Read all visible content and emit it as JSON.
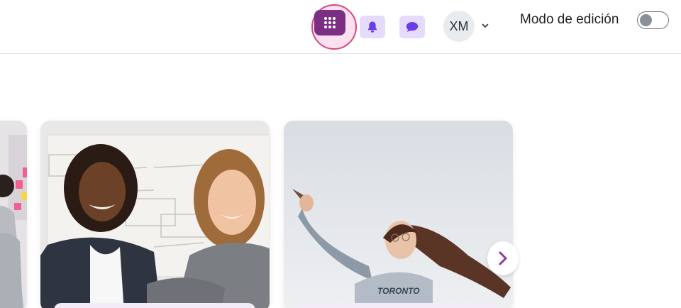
{
  "header": {
    "apps_icon": "grid-dots-icon",
    "notifications_icon": "bell-icon",
    "messages_icon": "chat-icon",
    "user_initials": "XM",
    "user_menu_icon": "chevron-down-icon",
    "edit_mode_label": "Modo de edición",
    "edit_mode_on": false
  },
  "carousel": {
    "next_icon": "chevron-right-icon"
  },
  "colors": {
    "apps_button": "#7a2f82",
    "focus_ring": "#d9457f",
    "icon_button_bg": "#e7dbfb",
    "icon_purple": "#6a3de8",
    "next_arrow": "#8a3b9a"
  }
}
